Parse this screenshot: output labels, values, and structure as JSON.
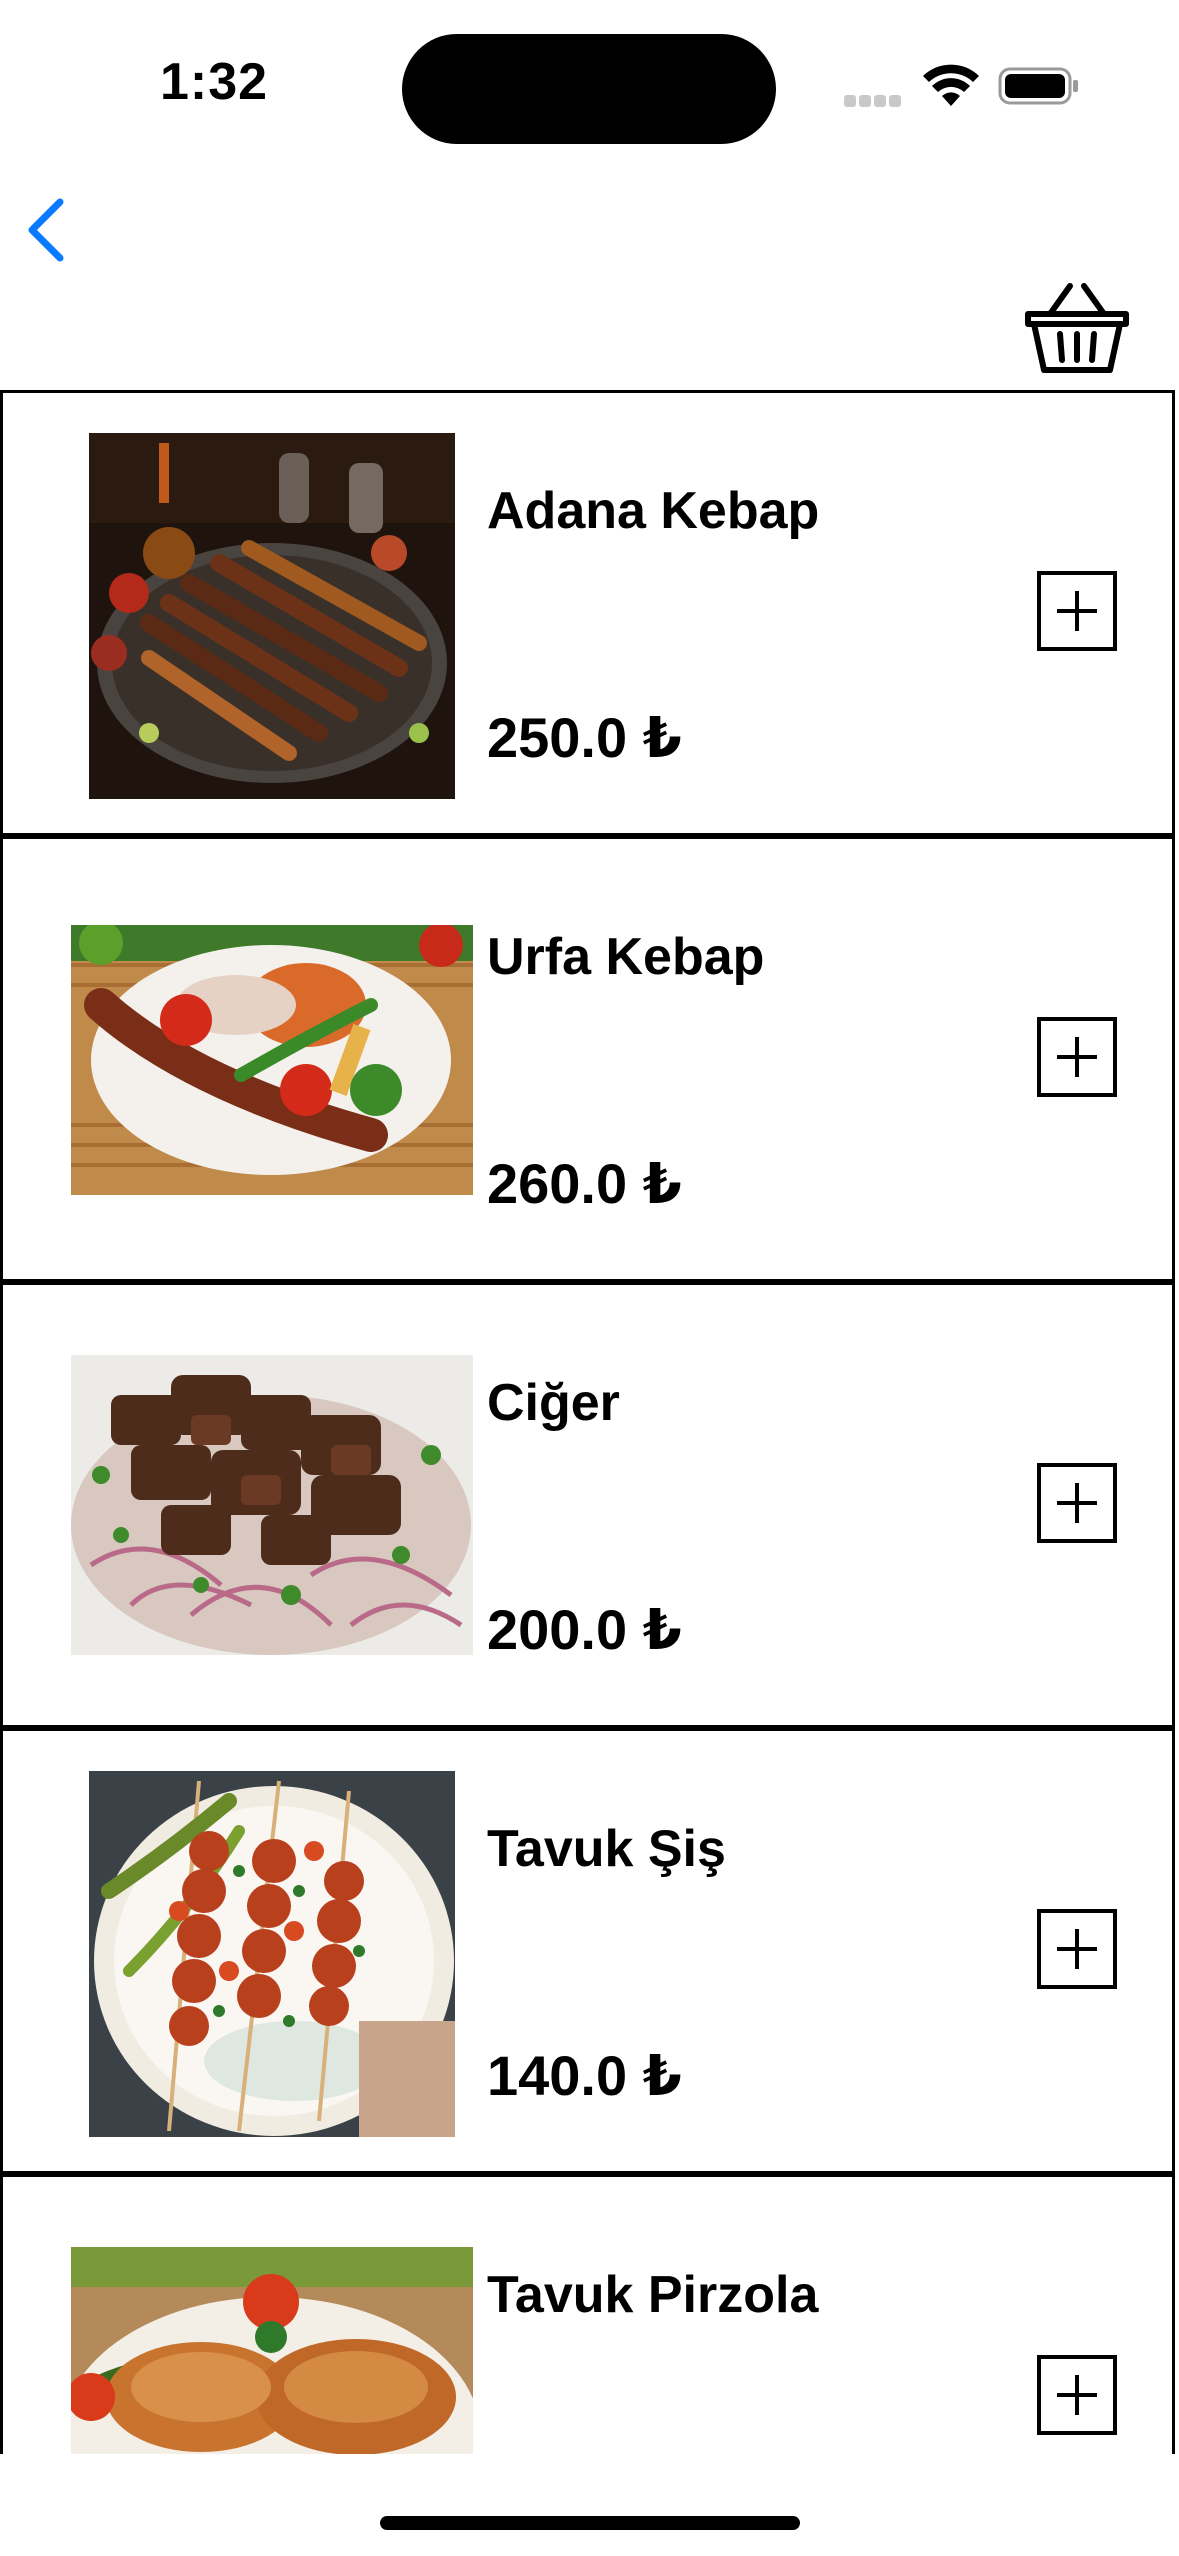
{
  "status_bar": {
    "time": "1:32"
  },
  "navigation": {
    "back_icon": "chevron-left-icon",
    "basket_icon": "basket-icon",
    "accent_color": "#0a7aff"
  },
  "menu": {
    "currency": "₺",
    "items": [
      {
        "name": "Adana Kebap",
        "price": "250.0 ₺",
        "image": "adana-kebap-photo"
      },
      {
        "name": "Urfa Kebap",
        "price": "260.0 ₺",
        "image": "urfa-kebap-photo"
      },
      {
        "name": "Ciğer",
        "price": "200.0 ₺",
        "image": "ciger-photo"
      },
      {
        "name": "Tavuk Şiş",
        "price": "140.0 ₺",
        "image": "tavuk-sis-photo"
      },
      {
        "name": "Tavuk Pirzola",
        "price": "",
        "image": "tavuk-pirzola-photo"
      }
    ]
  }
}
